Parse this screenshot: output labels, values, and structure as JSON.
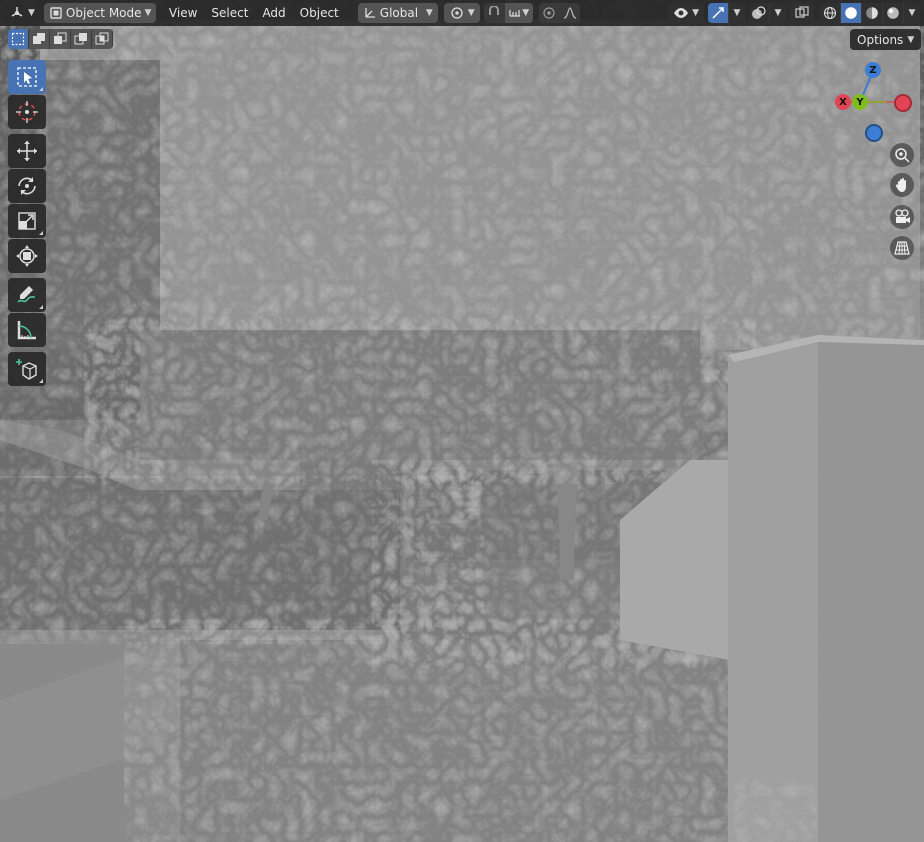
{
  "header": {
    "editor_type_icon": "3d-viewport-icon",
    "mode": {
      "label": "Object Mode",
      "icon": "object-mode-icon"
    },
    "menus": [
      "View",
      "Select",
      "Add",
      "Object"
    ],
    "orientation": {
      "label": "Global",
      "icon": "orientation-icon"
    },
    "pivot_icon": "pivot-icon",
    "snap_icon": "snap-icon",
    "snap_target_icon": "snap-increment-icon",
    "proportional_icon": "proportional-edit-icon",
    "falloff_icon": "falloff-curve-icon",
    "visibility_icon": "eye-icon",
    "gizmo_icon": "gizmo-icon",
    "overlay_icon": "overlay-icon",
    "xray_icon": "xray-icon",
    "shading_modes": [
      "wireframe",
      "solid",
      "material-preview",
      "rendered"
    ],
    "active_shading": "solid"
  },
  "toolsettings": {
    "select_modes": [
      "select-box",
      "select-extend",
      "select-subtract",
      "select-invert",
      "select-intersect"
    ],
    "options_label": "Options"
  },
  "toolbar": {
    "tools": [
      "select-box",
      "cursor",
      "move",
      "rotate",
      "scale",
      "transform",
      "annotate",
      "measure",
      "add-cube"
    ],
    "active_tool": "select-box"
  },
  "gizmo": {
    "x_label": "X",
    "y_label": "Y",
    "z_label": "Z",
    "colors": {
      "x": "#e34455",
      "y": "#7fbc1f",
      "z": "#3b7ed4"
    }
  },
  "colors": {
    "accent": "#4772b3",
    "header_bg": "#282828"
  }
}
